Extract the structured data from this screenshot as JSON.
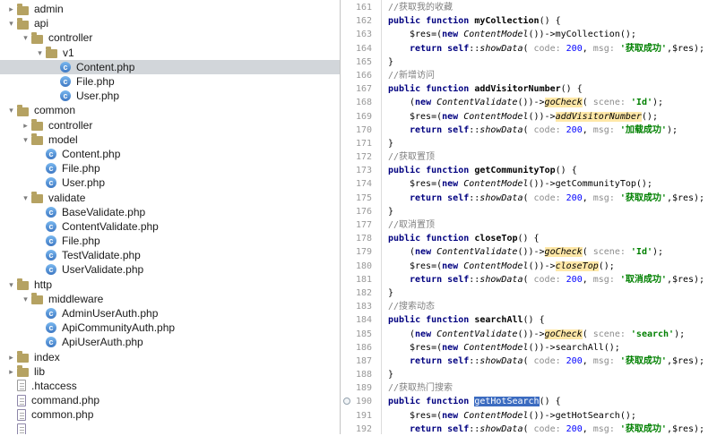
{
  "colors": {
    "tree_selection_inactive": "#d2d6da",
    "usage_highlight": "#ffe8a8",
    "identifier_selection": "#3b6bc0",
    "keyword": "#000080",
    "string": "#008000",
    "number": "#0000ff",
    "comment": "#808080",
    "line_number": "#999999"
  },
  "tree": {
    "items": [
      {
        "label": "admin",
        "type": "folder",
        "depth": 0,
        "chevron": "collapsed"
      },
      {
        "label": "api",
        "type": "folder",
        "depth": 0,
        "chevron": "expanded"
      },
      {
        "label": "controller",
        "type": "folder",
        "depth": 1,
        "chevron": "expanded"
      },
      {
        "label": "v1",
        "type": "folder",
        "depth": 2,
        "chevron": "expanded"
      },
      {
        "label": "Content.php",
        "type": "class",
        "depth": 3,
        "selected": true
      },
      {
        "label": "File.php",
        "type": "class",
        "depth": 3
      },
      {
        "label": "User.php",
        "type": "class",
        "depth": 3
      },
      {
        "label": "common",
        "type": "folder",
        "depth": 0,
        "chevron": "expanded"
      },
      {
        "label": "controller",
        "type": "folder",
        "depth": 1,
        "chevron": "collapsed"
      },
      {
        "label": "model",
        "type": "folder",
        "depth": 1,
        "chevron": "expanded"
      },
      {
        "label": "Content.php",
        "type": "class",
        "depth": 2
      },
      {
        "label": "File.php",
        "type": "class",
        "depth": 2
      },
      {
        "label": "User.php",
        "type": "class",
        "depth": 2
      },
      {
        "label": "validate",
        "type": "folder",
        "depth": 1,
        "chevron": "expanded"
      },
      {
        "label": "BaseValidate.php",
        "type": "class",
        "depth": 2
      },
      {
        "label": "ContentValidate.php",
        "type": "class",
        "depth": 2
      },
      {
        "label": "File.php",
        "type": "class",
        "depth": 2
      },
      {
        "label": "TestValidate.php",
        "type": "class",
        "depth": 2
      },
      {
        "label": "UserValidate.php",
        "type": "class",
        "depth": 2
      },
      {
        "label": "http",
        "type": "folder",
        "depth": 0,
        "chevron": "expanded"
      },
      {
        "label": "middleware",
        "type": "folder",
        "depth": 1,
        "chevron": "expanded"
      },
      {
        "label": "AdminUserAuth.php",
        "type": "class",
        "depth": 2
      },
      {
        "label": "ApiCommunityAuth.php",
        "type": "class",
        "depth": 2
      },
      {
        "label": "ApiUserAuth.php",
        "type": "class",
        "depth": 2
      },
      {
        "label": "index",
        "type": "folder",
        "depth": 0,
        "chevron": "collapsed"
      },
      {
        "label": "lib",
        "type": "folder",
        "depth": 0,
        "chevron": "collapsed"
      },
      {
        "label": ".htaccess",
        "type": "file",
        "depth": 0
      },
      {
        "label": "command.php",
        "type": "phpfile",
        "depth": 0
      },
      {
        "label": "common.php",
        "type": "phpfile",
        "depth": 0
      },
      {
        "label": "",
        "type": "phpfile",
        "depth": 0
      }
    ]
  },
  "editor": {
    "lines": [
      {
        "n": 161,
        "ind": 1,
        "seg": [
          [
            "cm",
            "//获取我的收藏"
          ]
        ]
      },
      {
        "n": 162,
        "ind": 1,
        "seg": [
          [
            "kw",
            "public function "
          ],
          [
            "fn",
            "myCollection"
          ],
          [
            "pln",
            "() {"
          ]
        ]
      },
      {
        "n": 163,
        "ind": 2,
        "seg": [
          [
            "pln",
            "$res=("
          ],
          [
            "kw",
            "new"
          ],
          [
            "pln",
            " "
          ],
          [
            "cls",
            "ContentModel"
          ],
          [
            "pln",
            "())->"
          ],
          [
            "call",
            "myCollection"
          ],
          [
            "pln",
            "();"
          ]
        ]
      },
      {
        "n": 164,
        "ind": 2,
        "seg": [
          [
            "kw",
            "return "
          ],
          [
            "kw",
            "self"
          ],
          [
            "pln",
            "::"
          ],
          [
            "mth",
            "showData"
          ],
          [
            "pln",
            "( "
          ],
          [
            "hint",
            "code:"
          ],
          [
            "pln",
            " "
          ],
          [
            "num",
            "200"
          ],
          [
            "pln",
            ", "
          ],
          [
            "hint",
            "msg:"
          ],
          [
            "pln",
            " "
          ],
          [
            "str",
            "'获取成功'"
          ],
          [
            "pln",
            ",$res);"
          ]
        ]
      },
      {
        "n": 165,
        "ind": 1,
        "seg": [
          [
            "pln",
            "}"
          ]
        ]
      },
      {
        "n": 166,
        "ind": 1,
        "seg": [
          [
            "cm",
            "//新增访问"
          ]
        ]
      },
      {
        "n": 167,
        "ind": 1,
        "seg": [
          [
            "kw",
            "public function "
          ],
          [
            "fn",
            "addVisitorNumber"
          ],
          [
            "pln",
            "() {"
          ]
        ]
      },
      {
        "n": 168,
        "ind": 2,
        "seg": [
          [
            "pln",
            "("
          ],
          [
            "kw",
            "new"
          ],
          [
            "pln",
            " "
          ],
          [
            "cls",
            "ContentValidate"
          ],
          [
            "pln",
            "())->"
          ],
          [
            "hl",
            "goCheck"
          ],
          [
            "pln",
            "( "
          ],
          [
            "hint",
            "scene:"
          ],
          [
            "pln",
            " "
          ],
          [
            "str",
            "'Id'"
          ],
          [
            "pln",
            ");"
          ]
        ]
      },
      {
        "n": 169,
        "ind": 2,
        "seg": [
          [
            "pln",
            "$res=("
          ],
          [
            "kw",
            "new"
          ],
          [
            "pln",
            " "
          ],
          [
            "cls",
            "ContentModel"
          ],
          [
            "pln",
            "())->"
          ],
          [
            "hl",
            "addVisitorNumber"
          ],
          [
            "pln",
            "();"
          ]
        ]
      },
      {
        "n": 170,
        "ind": 2,
        "seg": [
          [
            "kw",
            "return "
          ],
          [
            "kw",
            "self"
          ],
          [
            "pln",
            "::"
          ],
          [
            "mth",
            "showData"
          ],
          [
            "pln",
            "( "
          ],
          [
            "hint",
            "code:"
          ],
          [
            "pln",
            " "
          ],
          [
            "num",
            "200"
          ],
          [
            "pln",
            ", "
          ],
          [
            "hint",
            "msg:"
          ],
          [
            "pln",
            " "
          ],
          [
            "str",
            "'加载成功'"
          ],
          [
            "pln",
            ");"
          ]
        ]
      },
      {
        "n": 171,
        "ind": 1,
        "seg": [
          [
            "pln",
            "}"
          ]
        ]
      },
      {
        "n": 172,
        "ind": 1,
        "seg": [
          [
            "cm",
            "//获取置顶"
          ]
        ]
      },
      {
        "n": 173,
        "ind": 1,
        "seg": [
          [
            "kw",
            "public function "
          ],
          [
            "fn",
            "getCommunityTop"
          ],
          [
            "pln",
            "() {"
          ]
        ]
      },
      {
        "n": 174,
        "ind": 2,
        "seg": [
          [
            "pln",
            "$res=("
          ],
          [
            "kw",
            "new"
          ],
          [
            "pln",
            " "
          ],
          [
            "cls",
            "ContentModel"
          ],
          [
            "pln",
            "())->"
          ],
          [
            "call",
            "getCommunityTop"
          ],
          [
            "pln",
            "();"
          ]
        ]
      },
      {
        "n": 175,
        "ind": 2,
        "seg": [
          [
            "kw",
            "return "
          ],
          [
            "kw",
            "self"
          ],
          [
            "pln",
            "::"
          ],
          [
            "mth",
            "showData"
          ],
          [
            "pln",
            "( "
          ],
          [
            "hint",
            "code:"
          ],
          [
            "pln",
            " "
          ],
          [
            "num",
            "200"
          ],
          [
            "pln",
            ", "
          ],
          [
            "hint",
            "msg:"
          ],
          [
            "pln",
            " "
          ],
          [
            "str",
            "'获取成功'"
          ],
          [
            "pln",
            ",$res);"
          ]
        ]
      },
      {
        "n": 176,
        "ind": 1,
        "seg": [
          [
            "pln",
            "}"
          ]
        ]
      },
      {
        "n": 177,
        "ind": 1,
        "seg": [
          [
            "cm",
            "//取消置顶"
          ]
        ]
      },
      {
        "n": 178,
        "ind": 1,
        "seg": [
          [
            "kw",
            "public function "
          ],
          [
            "fn",
            "closeTop"
          ],
          [
            "pln",
            "() {"
          ]
        ]
      },
      {
        "n": 179,
        "ind": 2,
        "seg": [
          [
            "pln",
            "("
          ],
          [
            "kw",
            "new"
          ],
          [
            "pln",
            " "
          ],
          [
            "cls",
            "ContentValidate"
          ],
          [
            "pln",
            "())->"
          ],
          [
            "hl",
            "goCheck"
          ],
          [
            "pln",
            "( "
          ],
          [
            "hint",
            "scene:"
          ],
          [
            "pln",
            " "
          ],
          [
            "str",
            "'Id'"
          ],
          [
            "pln",
            ");"
          ]
        ]
      },
      {
        "n": 180,
        "ind": 2,
        "seg": [
          [
            "pln",
            "$res=("
          ],
          [
            "kw",
            "new"
          ],
          [
            "pln",
            " "
          ],
          [
            "cls",
            "ContentModel"
          ],
          [
            "pln",
            "())->"
          ],
          [
            "hl",
            "closeTop"
          ],
          [
            "pln",
            "();"
          ]
        ]
      },
      {
        "n": 181,
        "ind": 2,
        "seg": [
          [
            "kw",
            "return "
          ],
          [
            "kw",
            "self"
          ],
          [
            "pln",
            "::"
          ],
          [
            "mth",
            "showData"
          ],
          [
            "pln",
            "( "
          ],
          [
            "hint",
            "code:"
          ],
          [
            "pln",
            " "
          ],
          [
            "num",
            "200"
          ],
          [
            "pln",
            ", "
          ],
          [
            "hint",
            "msg:"
          ],
          [
            "pln",
            " "
          ],
          [
            "str",
            "'取消成功'"
          ],
          [
            "pln",
            ",$res);"
          ]
        ]
      },
      {
        "n": 182,
        "ind": 1,
        "seg": [
          [
            "pln",
            "}"
          ]
        ]
      },
      {
        "n": 183,
        "ind": 1,
        "seg": [
          [
            "cm",
            "//搜索动态"
          ]
        ]
      },
      {
        "n": 184,
        "ind": 1,
        "seg": [
          [
            "kw",
            "public function "
          ],
          [
            "fn",
            "searchAll"
          ],
          [
            "pln",
            "() {"
          ]
        ]
      },
      {
        "n": 185,
        "ind": 2,
        "seg": [
          [
            "pln",
            "("
          ],
          [
            "kw",
            "new"
          ],
          [
            "pln",
            " "
          ],
          [
            "cls",
            "ContentValidate"
          ],
          [
            "pln",
            "())->"
          ],
          [
            "hl",
            "goCheck"
          ],
          [
            "pln",
            "( "
          ],
          [
            "hint",
            "scene:"
          ],
          [
            "pln",
            " "
          ],
          [
            "str",
            "'search'"
          ],
          [
            "pln",
            ");"
          ]
        ]
      },
      {
        "n": 186,
        "ind": 2,
        "seg": [
          [
            "pln",
            "$res=("
          ],
          [
            "kw",
            "new"
          ],
          [
            "pln",
            " "
          ],
          [
            "cls",
            "ContentModel"
          ],
          [
            "pln",
            "())->"
          ],
          [
            "call",
            "searchAll"
          ],
          [
            "pln",
            "();"
          ]
        ]
      },
      {
        "n": 187,
        "ind": 2,
        "seg": [
          [
            "kw",
            "return "
          ],
          [
            "kw",
            "self"
          ],
          [
            "pln",
            "::"
          ],
          [
            "mth",
            "showData"
          ],
          [
            "pln",
            "( "
          ],
          [
            "hint",
            "code:"
          ],
          [
            "pln",
            " "
          ],
          [
            "num",
            "200"
          ],
          [
            "pln",
            ", "
          ],
          [
            "hint",
            "msg:"
          ],
          [
            "pln",
            " "
          ],
          [
            "str",
            "'获取成功'"
          ],
          [
            "pln",
            ",$res);"
          ]
        ]
      },
      {
        "n": 188,
        "ind": 1,
        "seg": [
          [
            "pln",
            "}"
          ]
        ]
      },
      {
        "n": 189,
        "ind": 1,
        "seg": [
          [
            "cm",
            "//获取热门搜索"
          ]
        ]
      },
      {
        "n": 190,
        "ind": 1,
        "mark": true,
        "seg": [
          [
            "kw",
            "public function "
          ],
          [
            "sel",
            "getHotSearch"
          ],
          [
            "pln",
            "() {"
          ]
        ]
      },
      {
        "n": 191,
        "ind": 2,
        "seg": [
          [
            "pln",
            "$res=("
          ],
          [
            "kw",
            "new"
          ],
          [
            "pln",
            " "
          ],
          [
            "cls",
            "ContentModel"
          ],
          [
            "pln",
            "())->"
          ],
          [
            "call",
            "getHotSearch"
          ],
          [
            "pln",
            "();"
          ]
        ]
      },
      {
        "n": 192,
        "ind": 2,
        "seg": [
          [
            "kw",
            "return "
          ],
          [
            "kw",
            "self"
          ],
          [
            "pln",
            "::"
          ],
          [
            "mth",
            "showData"
          ],
          [
            "pln",
            "( "
          ],
          [
            "hint",
            "code:"
          ],
          [
            "pln",
            " "
          ],
          [
            "num",
            "200"
          ],
          [
            "pln",
            ", "
          ],
          [
            "hint",
            "msg:"
          ],
          [
            "pln",
            " "
          ],
          [
            "str",
            "'获取成功'"
          ],
          [
            "pln",
            ",$res);"
          ]
        ]
      }
    ]
  }
}
